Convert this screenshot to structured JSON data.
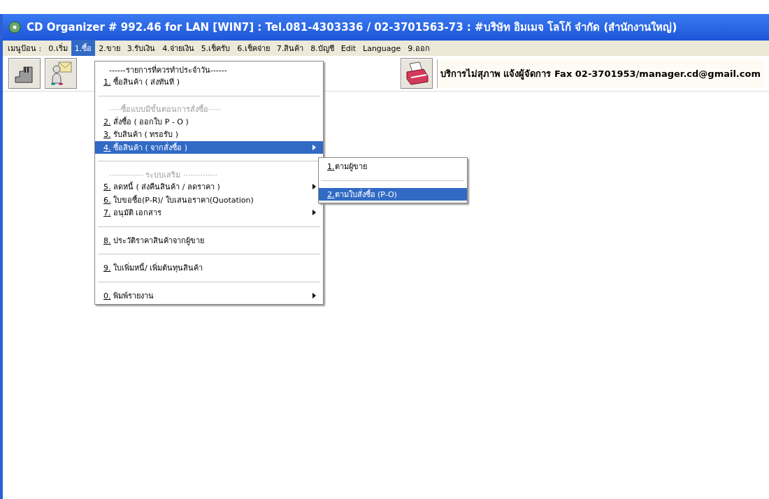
{
  "window": {
    "title": "CD Organizer # 992.46  for  LAN  [WIN7] : Tel.081-4303336 / 02-3701563-73 : #บริษัท อิมเมจ โลโก้ จำกัด (สำนักงานใหญ่)"
  },
  "menu_bar": {
    "label": "เมนูป้อน :",
    "items": [
      {
        "label": "0.เริ่ม",
        "selected": false
      },
      {
        "label": "1.ซื้อ",
        "selected": true
      },
      {
        "label": "2.ขาย",
        "selected": false
      },
      {
        "label": "3.รับเงิน",
        "selected": false
      },
      {
        "label": "4.จ่ายเงิน",
        "selected": false
      },
      {
        "label": "5.เช็ครับ",
        "selected": false
      },
      {
        "label": "6.เช็คจ่าย",
        "selected": false
      },
      {
        "label": "7.สินค้า",
        "selected": false
      },
      {
        "label": "8.บัญชี",
        "selected": false
      },
      {
        "label": "Edit",
        "selected": false
      },
      {
        "label": "Language",
        "selected": false
      },
      {
        "label": "9.ออก",
        "selected": false
      }
    ]
  },
  "toolbar": {
    "notice": "บริการไม่สุภาพ แจ้งผู้จัดการ Fax 02-3701953/manager.cd@gmail.com"
  },
  "menu": {
    "items": [
      {
        "kind": "header",
        "label": "------รายการที่ควรทำประจำวัน------",
        "disabled": false
      },
      {
        "kind": "item",
        "label": "1. ซื้อสินค้า ( ส่งทันที )",
        "selected": false,
        "submenu": false
      },
      {
        "kind": "separator"
      },
      {
        "kind": "header",
        "label": "·····ซื้อแบบมีขั้นตอนการสั่งซื้อ·····",
        "disabled": true
      },
      {
        "kind": "item",
        "label": "2. สั่งซื้อ  ( ออกใบ P - O )",
        "selected": false,
        "submenu": false
      },
      {
        "kind": "item",
        "label": "3. รับสินค้า  ( ทรอรับ )",
        "selected": false,
        "submenu": false
      },
      {
        "kind": "item",
        "label": "4. ซื้อสินค้า ( จากสั่งซื้อ )",
        "selected": true,
        "submenu": true
      },
      {
        "kind": "separator"
      },
      {
        "kind": "header",
        "label": "·············· ระบบเสริม ··············",
        "disabled": true
      },
      {
        "kind": "item",
        "label": "5. ลดหนี้  ( ส่งคืนสินค้า / ลดราคา )",
        "selected": false,
        "submenu": true
      },
      {
        "kind": "item",
        "label": "6. ใบขอซื้อ(P-R)/ ใบเสนอราคา(Quotation)",
        "selected": false,
        "submenu": false
      },
      {
        "kind": "item",
        "label": "7. อนุมัติ เอกสาร",
        "selected": false,
        "submenu": true
      },
      {
        "kind": "separator"
      },
      {
        "kind": "item",
        "label": "8. ประวัติราคาสินค้าจากผู้ขาย",
        "selected": false,
        "submenu": false
      },
      {
        "kind": "separator"
      },
      {
        "kind": "item",
        "label": "9.  ใบเพิ่มหนี้/ เพิ่มต้นทุนสินค้า",
        "selected": false,
        "submenu": false
      },
      {
        "kind": "separator"
      },
      {
        "kind": "item",
        "label": "0. พิมพ์รายงาน",
        "selected": false,
        "submenu": true
      }
    ]
  },
  "submenu": {
    "items": [
      {
        "kind": "item",
        "label": "1.ตามผู้ขาย",
        "selected": false
      },
      {
        "kind": "separator"
      },
      {
        "kind": "item",
        "label": "2.ตามใบสั่งซื้อ (P-O)",
        "selected": true
      }
    ]
  }
}
